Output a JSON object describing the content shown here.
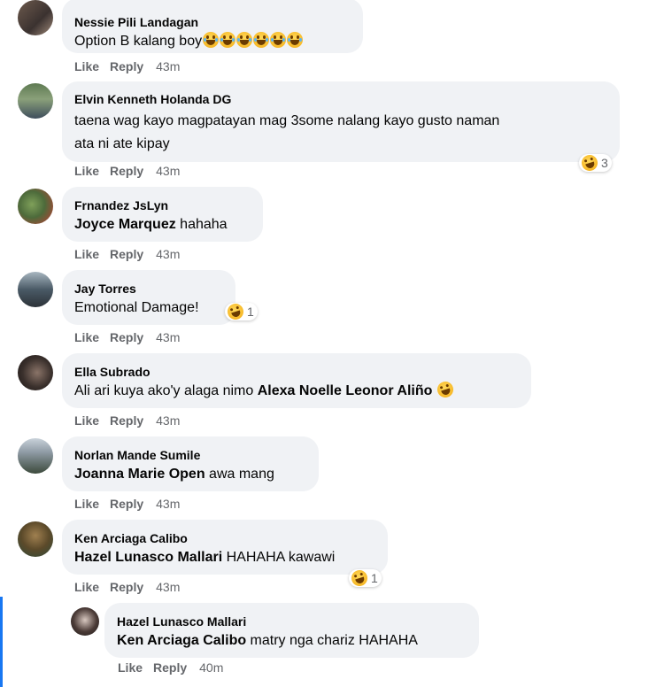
{
  "actions": {
    "like": "Like",
    "reply": "Reply"
  },
  "comments": [
    {
      "author": "Nessie Pili Landagan",
      "text": "Option B kalang boy",
      "emoji_count": 6,
      "time": "43m"
    },
    {
      "author": "Elvin Kenneth Holanda DG",
      "line1": "taena wag kayo magpatayan mag 3some nalang kayo gusto naman",
      "line2": "ata ni ate kipay",
      "time": "43m",
      "reaction_count": "3"
    },
    {
      "author": "Frnandez JsLyn",
      "tag": "Joyce Marquez",
      "text": " hahaha",
      "time": "43m"
    },
    {
      "author": "Jay Torres",
      "text": "Emotional Damage!",
      "time": "43m",
      "reaction_count": "1"
    },
    {
      "author": "Ella Subrado",
      "text": "Ali ari kuya ako'y alaga nimo ",
      "tag": "Alexa Noelle Leonor Aliño",
      "time": "43m"
    },
    {
      "author": "Norlan Mande Sumile",
      "tag": "Joanna Marie Open",
      "text": " awa mang",
      "time": "43m"
    },
    {
      "author": "Ken Arciaga Calibo",
      "tag": "Hazel Lunasco Mallari",
      "text": " HAHAHA kawawi",
      "time": "43m",
      "reaction_count": "1"
    },
    {
      "author": "Hazel Lunasco Mallari",
      "tag": "Ken Arciaga Calibo",
      "text": " matry nga chariz HAHAHA",
      "time": "40m"
    }
  ]
}
